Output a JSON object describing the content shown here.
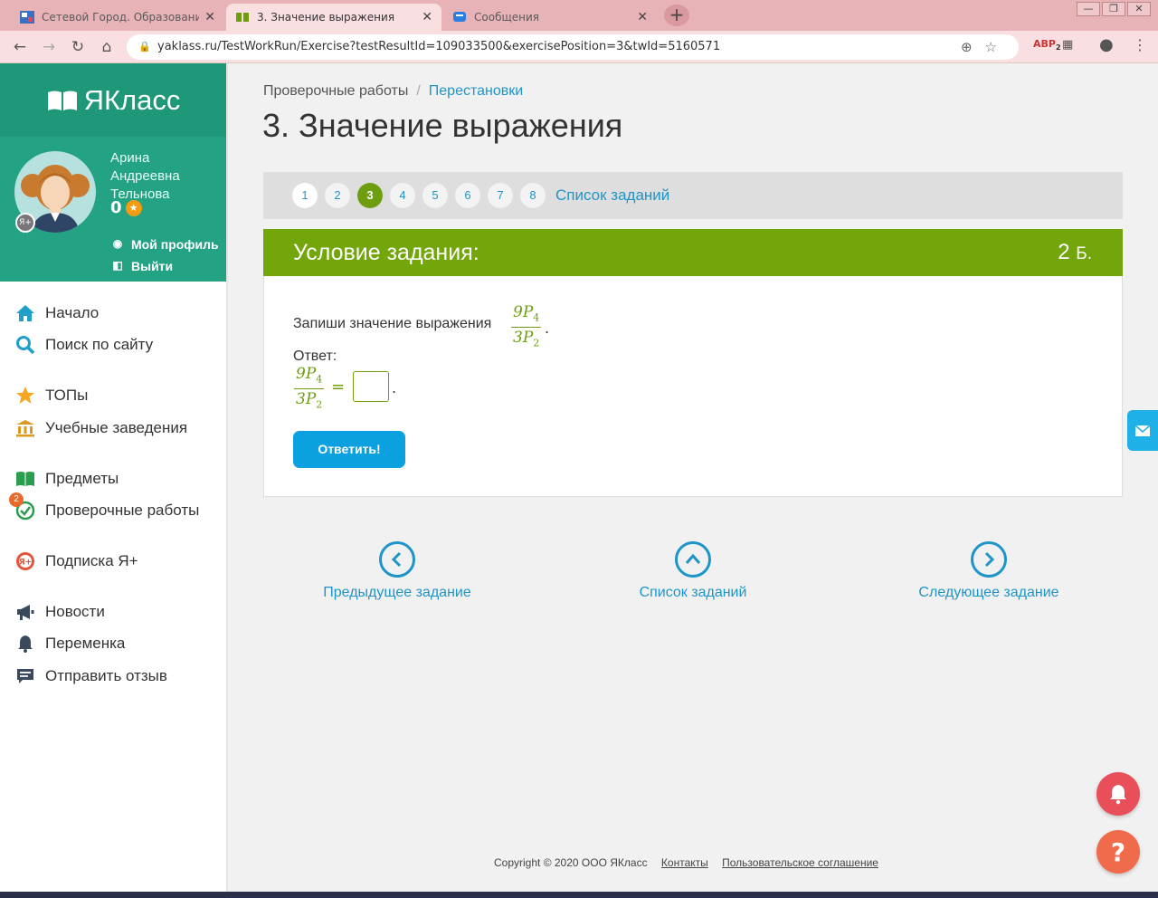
{
  "browser": {
    "tabs": [
      {
        "title": "Сетевой Город. Образование. У",
        "active": false
      },
      {
        "title": "3. Значение выражения",
        "active": true
      },
      {
        "title": "Сообщения",
        "active": false
      }
    ],
    "url": "yaklass.ru/TestWorkRun/Exercise?testResultId=109033500&exercisePosition=3&twId=5160571",
    "ext_badge": "2"
  },
  "sidebar": {
    "logo": "ЯКласс",
    "user_name": "Арина Андреевна Тельнова",
    "points": "0",
    "avatar_badge": "Я+",
    "profile_link": "Мой профиль",
    "logout_link": "Выйти",
    "items": [
      {
        "label": "Начало",
        "icon": "home-icon"
      },
      {
        "label": "Поиск по сайту",
        "icon": "search-icon"
      },
      {
        "label": "ТОПы",
        "icon": "star-icon"
      },
      {
        "label": "Учебные заведения",
        "icon": "institution-icon"
      },
      {
        "label": "Предметы",
        "icon": "book-icon"
      },
      {
        "label": "Проверочные работы",
        "icon": "check-icon",
        "badge": "2"
      },
      {
        "label": "Подписка Я+",
        "icon": "subscription-icon"
      },
      {
        "label": "Новости",
        "icon": "megaphone-icon"
      },
      {
        "label": "Переменка",
        "icon": "bell-icon"
      },
      {
        "label": "Отправить отзыв",
        "icon": "feedback-icon"
      }
    ]
  },
  "breadcrumb": {
    "root": "Проверочные работы",
    "current": "Перестановки"
  },
  "page_title": "3. Значение выражения",
  "pager": {
    "pages": [
      "1",
      "2",
      "3",
      "4",
      "5",
      "6",
      "7",
      "8"
    ],
    "current": "3",
    "list_label": "Список заданий"
  },
  "task": {
    "header": "Условие задания:",
    "score": "2",
    "score_unit": "Б.",
    "question": "Запиши значение выражения",
    "num": "9P",
    "num_sub": "4",
    "den": "3P",
    "den_sub": "2",
    "answer_label": "Ответ:",
    "answer_value": "",
    "submit": "Ответить!"
  },
  "bottom_nav": {
    "prev": "Предыдущее задание",
    "list": "Список заданий",
    "next": "Следующее задание"
  },
  "footer": {
    "copyright": "Copyright © 2020 ООО ЯКласс",
    "contacts": "Контакты",
    "agreement": "Пользовательское соглашение"
  },
  "colors": {
    "green": "#72a60a",
    "teal": "#23a384",
    "blue": "#1e95c8",
    "button": "#0ba1e0",
    "alert": "#e94f5a",
    "help": "#f06a4c"
  }
}
